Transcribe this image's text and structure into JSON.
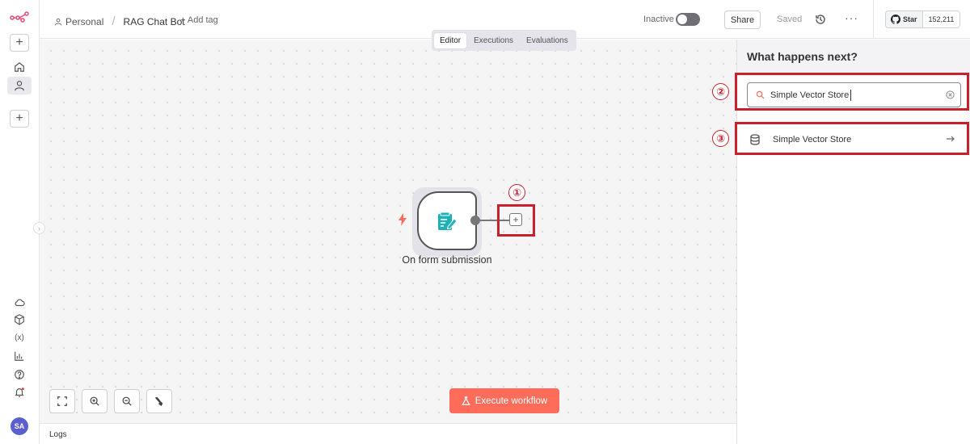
{
  "sidebar": {
    "logo": "n8n-logo",
    "avatar_initials": "SA",
    "icons": [
      "add-icon",
      "home-icon",
      "user-icon",
      "add-project-icon",
      "cloud-icon",
      "cube-icon",
      "variables-icon",
      "insights-icon",
      "help-icon",
      "bell-icon"
    ]
  },
  "header": {
    "breadcrumb_project": "Personal",
    "breadcrumb_separator": "/",
    "workflow_name": "RAG Chat Bot",
    "add_tag": "+ Add tag",
    "active_label": "Inactive",
    "share_label": "Share",
    "saved_label": "Saved",
    "more_label": "···",
    "github": {
      "star_label": "Star",
      "star_count": "152,211"
    }
  },
  "canvas": {
    "tabs": [
      {
        "label": "Editor",
        "active": true
      },
      {
        "label": "Executions",
        "active": false
      },
      {
        "label": "Evaluations",
        "active": false
      }
    ],
    "node_label": "On form submission",
    "add_node_symbol": "+",
    "execute_label": "Execute workflow",
    "annotations": [
      "①",
      "②",
      "③"
    ]
  },
  "logs_label": "Logs",
  "panel": {
    "title": "What happens next?",
    "search_value": "Simple Vector Store",
    "results": [
      {
        "label": "Simple Vector Store"
      }
    ]
  },
  "colors": {
    "accent": "#ff6d5a",
    "annotation": "#c8202c",
    "node_icon": "#1fb0b8",
    "avatar": "#5c5fcf"
  }
}
